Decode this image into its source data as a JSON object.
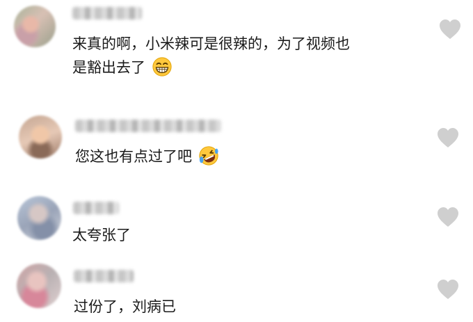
{
  "comments": [
    {
      "line1": "来真的啊，小米辣可是很辣的，为了视频也",
      "line2": "是豁出去了",
      "emoji": "grinning-face-with-smiling-eyes"
    },
    {
      "text": "您这也有点过了吧",
      "emoji": "rolling-on-the-floor-laughing"
    },
    {
      "text": "太夸张了"
    },
    {
      "text": "过份了，刘病已"
    }
  ],
  "colors": {
    "text": "#1a1a1a",
    "like_icon": "#cfcfcf",
    "emoji_face": "#ffc83d"
  },
  "icons": {
    "like": "heart-icon"
  }
}
